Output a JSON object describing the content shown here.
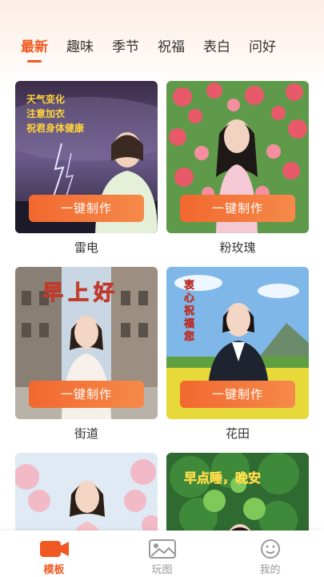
{
  "tabs": [
    "最新",
    "趣味",
    "季节",
    "祝福",
    "表白",
    "问好"
  ],
  "cards": [
    {
      "caption": "雷电",
      "button": "一键制作",
      "overlay": [
        "天气变化",
        "注意加衣",
        "祝君身体健康"
      ]
    },
    {
      "caption": "粉玫瑰",
      "button": "一键制作"
    },
    {
      "caption": "街道",
      "button": "一键制作",
      "overlay": [
        "早上好"
      ]
    },
    {
      "caption": "花田",
      "button": "一键制作",
      "overlay": [
        "衷心祝福您"
      ]
    },
    {
      "caption": "",
      "button": ""
    },
    {
      "caption": "",
      "button": "",
      "overlay": [
        "早点睡，晚安"
      ]
    }
  ],
  "nav": [
    {
      "label": "模板",
      "icon": "video-camera-icon",
      "active": true
    },
    {
      "label": "玩图",
      "icon": "image-icon",
      "active": false
    },
    {
      "label": "我的",
      "icon": "smiley-icon",
      "active": false
    }
  ],
  "colors": {
    "accent": "#f05a22",
    "button": "#f2682f"
  }
}
